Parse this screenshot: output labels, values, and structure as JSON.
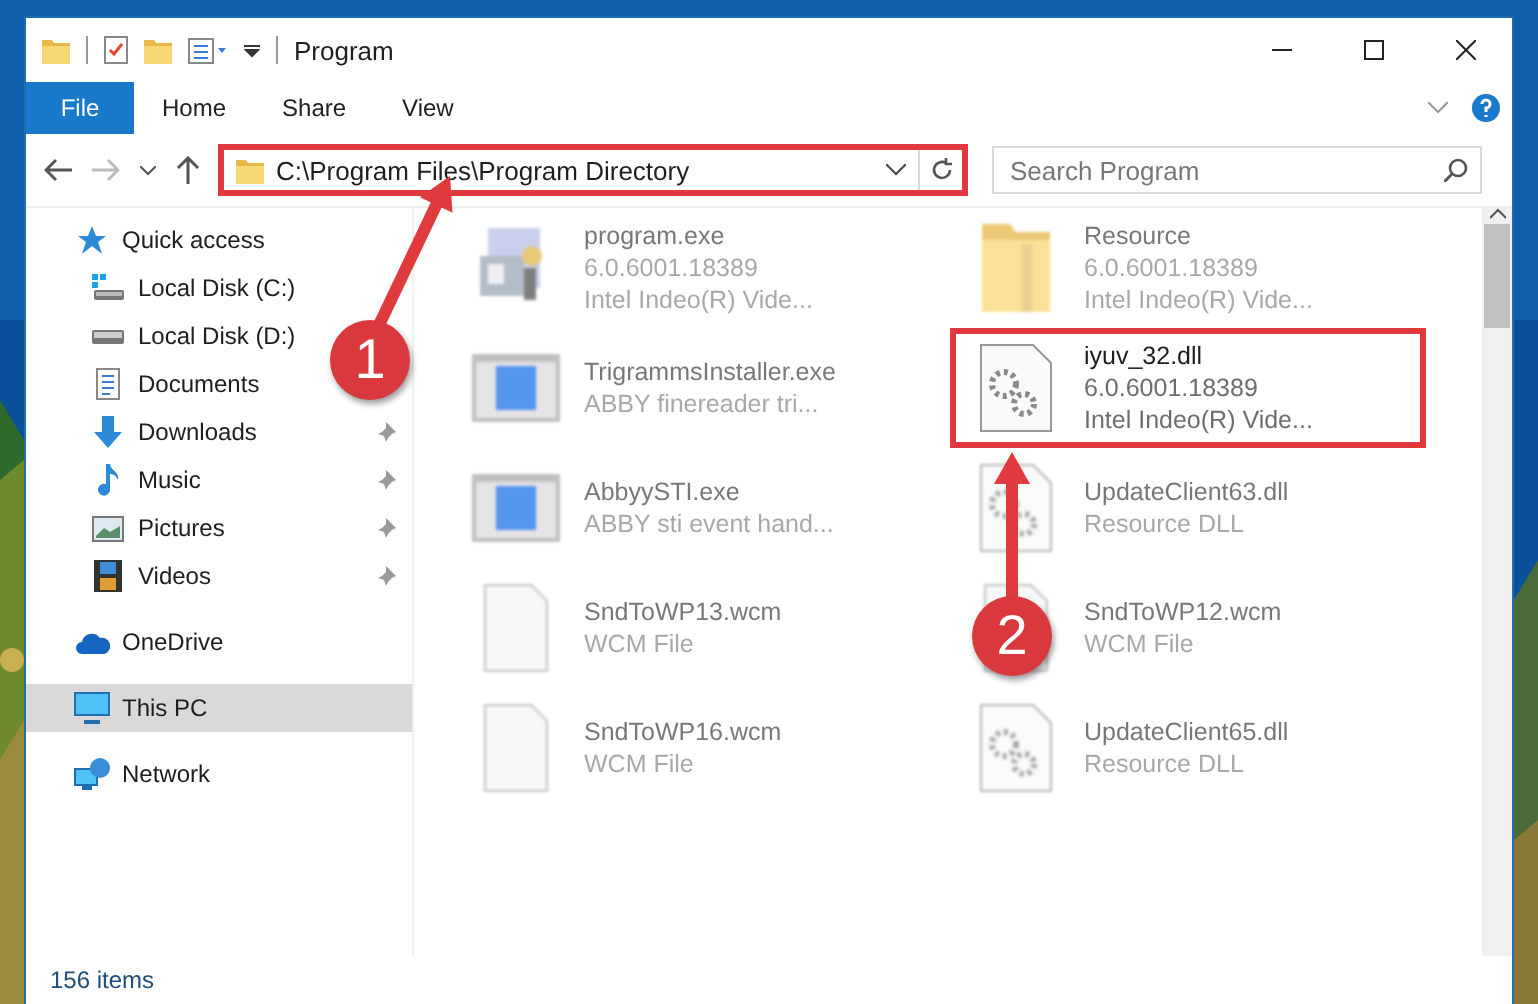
{
  "window": {
    "title": "Program"
  },
  "ribbon_tabs": [
    {
      "label": "File",
      "selected": true
    },
    {
      "label": "Home",
      "selected": false
    },
    {
      "label": "Share",
      "selected": false
    },
    {
      "label": "View",
      "selected": false
    }
  ],
  "address_bar": {
    "value": "C:\\Program Files\\Program Directory",
    "highlighted": true
  },
  "search": {
    "placeholder": "Search Program"
  },
  "navigation": [
    {
      "label": "Quick access",
      "selected": false,
      "children": [
        {
          "label": "Local Disk (C:)",
          "selected": false,
          "pinned": false
        },
        {
          "label": "Local Disk (D:)",
          "selected": false,
          "pinned": false
        },
        {
          "label": "Documents",
          "selected": false,
          "pinned": false
        },
        {
          "label": "Downloads",
          "selected": false,
          "pinned": true
        },
        {
          "label": "Music",
          "selected": false,
          "pinned": true
        },
        {
          "label": "Pictures",
          "selected": false,
          "pinned": true
        },
        {
          "label": "Videos",
          "selected": false,
          "pinned": true
        }
      ]
    },
    {
      "label": "OneDrive",
      "selected": false
    },
    {
      "label": "This PC",
      "selected": true
    },
    {
      "label": "Network",
      "selected": false
    }
  ],
  "files": [
    {
      "name": "program.exe",
      "details": [
        "6.0.6001.18389",
        "Intel Indeo(R) Vide..."
      ],
      "kind": "app",
      "blurred": true,
      "highlighted": false
    },
    {
      "name": "TrigrammsInstaller.exe",
      "details": [
        "ABBY finereader tri..."
      ],
      "kind": "window",
      "blurred": true,
      "highlighted": false
    },
    {
      "name": "AbbyySTI.exe",
      "details": [
        "ABBY sti event hand..."
      ],
      "kind": "window",
      "blurred": true,
      "highlighted": false
    },
    {
      "name": "SndToWP13.wcm",
      "details": [
        "WCM File"
      ],
      "kind": "blank",
      "blurred": true,
      "highlighted": false
    },
    {
      "name": "SndToWP16.wcm",
      "details": [
        "WCM File"
      ],
      "kind": "blank",
      "blurred": true,
      "highlighted": false
    },
    {
      "name": "Resource",
      "details": [
        "6.0.6001.18389",
        "Intel Indeo(R) Vide..."
      ],
      "kind": "folder",
      "blurred": true,
      "highlighted": false
    },
    {
      "name": "iyuv_32.dll",
      "details": [
        "6.0.6001.18389",
        "Intel Indeo(R) Vide..."
      ],
      "kind": "dll",
      "blurred": false,
      "highlighted": true
    },
    {
      "name": "UpdateClient63.dll",
      "details": [
        "Resource DLL"
      ],
      "kind": "dll",
      "blurred": true,
      "highlighted": false
    },
    {
      "name": "SndToWP12.wcm",
      "details": [
        "WCM File"
      ],
      "kind": "blank",
      "blurred": true,
      "highlighted": false
    },
    {
      "name": "UpdateClient65.dll",
      "details": [
        "Resource DLL"
      ],
      "kind": "dll",
      "blurred": true,
      "highlighted": false
    }
  ],
  "status_bar": {
    "item_count": "156 items"
  },
  "callouts": [
    {
      "number": "1"
    },
    {
      "number": "2"
    }
  ]
}
